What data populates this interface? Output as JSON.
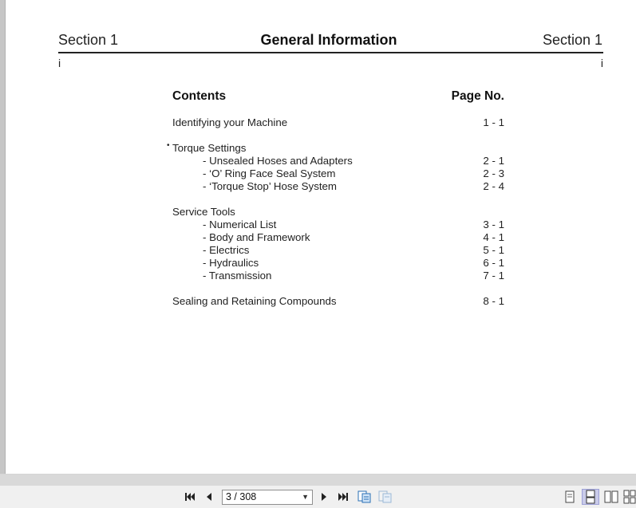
{
  "header": {
    "section_left": "Section 1",
    "title": "General Information",
    "section_right": "Section 1",
    "page_left": "i",
    "page_right": "i"
  },
  "toc": {
    "heading": "Contents",
    "page_heading": "Page No.",
    "items": [
      {
        "title": "Identifying your Machine",
        "page": "1 - 1"
      },
      {
        "title": "Torque Settings",
        "page": "",
        "bullet": "•"
      },
      {
        "title": "- Unsealed Hoses and Adapters",
        "page": "2 - 1"
      },
      {
        "title": "- ‘O’ Ring Face Seal System",
        "page": "2 - 3"
      },
      {
        "title": "- ‘Torque Stop’ Hose System",
        "page": "2 - 4"
      },
      {
        "title": "Service Tools",
        "page": ""
      },
      {
        "title": "- Numerical List",
        "page": "3 - 1"
      },
      {
        "title": "- Body and Framework",
        "page": "4 - 1"
      },
      {
        "title": "- Electrics",
        "page": "5 - 1"
      },
      {
        "title": "- Hydraulics",
        "page": "6 - 1"
      },
      {
        "title": "- Transmission",
        "page": "7 - 1"
      },
      {
        "title": "Sealing and Retaining Compounds",
        "page": "8 - 1"
      }
    ]
  },
  "toolbar": {
    "page_indicator": "3 / 308",
    "icons": [
      "first-page-icon",
      "previous-page-icon",
      "next-page-icon",
      "last-page-icon",
      "copy-page-icon",
      "paste-page-icon",
      "single-page-view-icon",
      "continuous-view-icon",
      "two-page-view-icon",
      "two-page-continuous-view-icon"
    ]
  }
}
